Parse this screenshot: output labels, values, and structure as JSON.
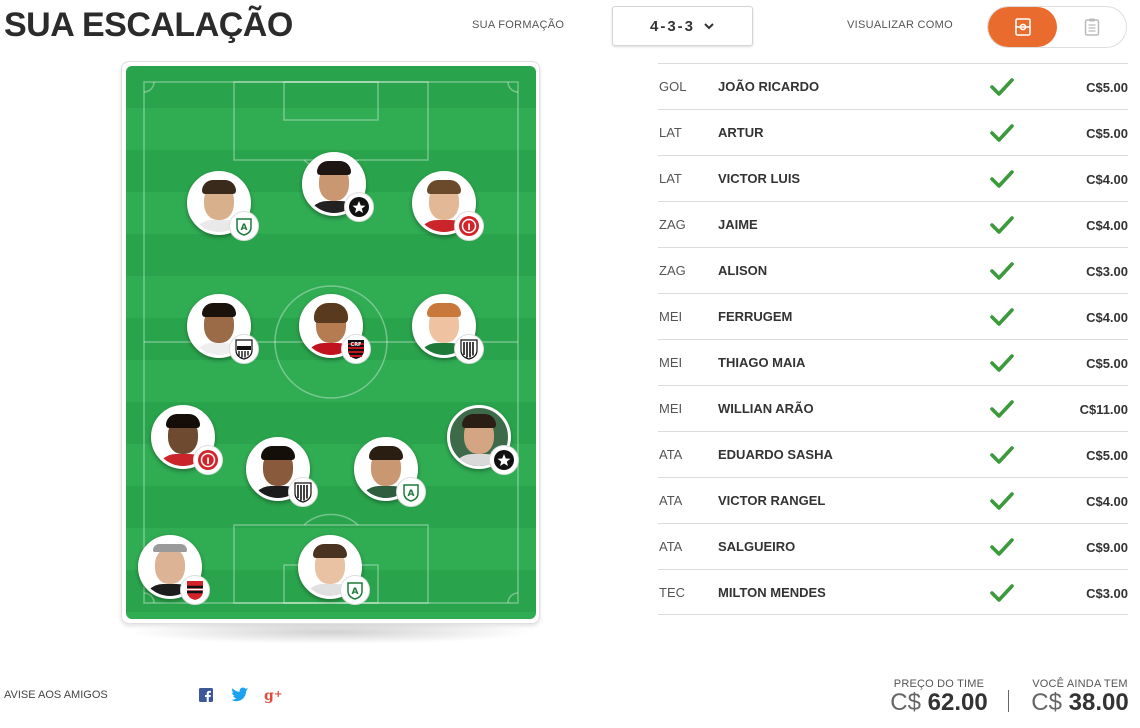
{
  "header": {
    "title": "SUA ESCALAÇÃO",
    "formation_label": "SUA FORMAÇÃO",
    "formation_value": "4-3-3",
    "view_label": "VISUALIZAR COMO",
    "view_options": [
      "field-icon",
      "clipboard-icon"
    ],
    "view_active": "field-icon"
  },
  "colors": {
    "accent": "#e96b2d",
    "check": "#3c9a3c",
    "field_dark": "#2aa44c",
    "field_light": "#30ac53"
  },
  "lineup": [
    {
      "pos": "GOL",
      "name": "JOÃO RICARDO",
      "price": "C$5.00"
    },
    {
      "pos": "LAT",
      "name": "ARTUR",
      "price": "C$5.00"
    },
    {
      "pos": "LAT",
      "name": "VICTOR LUIS",
      "price": "C$4.00"
    },
    {
      "pos": "ZAG",
      "name": "JAIME",
      "price": "C$4.00"
    },
    {
      "pos": "ZAG",
      "name": "ALISON",
      "price": "C$3.00"
    },
    {
      "pos": "MEI",
      "name": "FERRUGEM",
      "price": "C$4.00"
    },
    {
      "pos": "MEI",
      "name": "THIAGO MAIA",
      "price": "C$5.00"
    },
    {
      "pos": "MEI",
      "name": "WILLIAN ARÃO",
      "price": "C$11.00"
    },
    {
      "pos": "ATA",
      "name": "EDUARDO SASHA",
      "price": "C$5.00"
    },
    {
      "pos": "ATA",
      "name": "VICTOR RANGEL",
      "price": "C$4.00"
    },
    {
      "pos": "ATA",
      "name": "SALGUEIRO",
      "price": "C$9.00"
    },
    {
      "pos": "TEC",
      "name": "MILTON MENDES",
      "price": "C$3.00"
    }
  ],
  "footer": {
    "share_label": "AVISE AOS AMIGOS",
    "share_icons": [
      "facebook-icon",
      "twitter-icon",
      "google-plus-icon"
    ],
    "team_price_label": "PREÇO DO TIME",
    "team_price_currency": "C$",
    "team_price_value": "62.00",
    "remaining_label": "VOCÊ AINDA TEM",
    "remaining_currency": "C$",
    "remaining_value": "38.00"
  }
}
